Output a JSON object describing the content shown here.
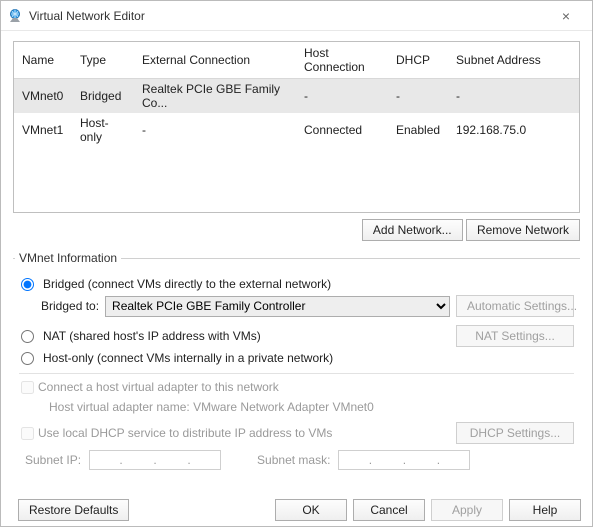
{
  "window": {
    "title": "Virtual Network Editor",
    "close_glyph": "×"
  },
  "table": {
    "headers": {
      "name": "Name",
      "type": "Type",
      "external": "External Connection",
      "host": "Host Connection",
      "dhcp": "DHCP",
      "subnet": "Subnet Address"
    },
    "rows": [
      {
        "name": "VMnet0",
        "type": "Bridged",
        "external": "Realtek PCIe GBE Family Co...",
        "host": "-",
        "dhcp": "-",
        "subnet": "-"
      },
      {
        "name": "VMnet1",
        "type": "Host-only",
        "external": "-",
        "host": "Connected",
        "dhcp": "Enabled",
        "subnet": "192.168.75.0"
      }
    ]
  },
  "buttons": {
    "add_network": "Add Network...",
    "remove_network": "Remove Network",
    "automatic_settings": "Automatic Settings...",
    "nat_settings": "NAT Settings...",
    "dhcp_settings": "DHCP Settings...",
    "restore_defaults": "Restore Defaults",
    "ok": "OK",
    "cancel": "Cancel",
    "apply": "Apply",
    "help": "Help"
  },
  "group": {
    "title": "VMnet Information",
    "bridged_label": "Bridged (connect VMs directly to the external network)",
    "bridged_to_label": "Bridged to:",
    "bridged_adapter": "Realtek PCIe GBE Family Controller",
    "nat_label": "NAT (shared host's IP address with VMs)",
    "hostonly_label": "Host-only (connect VMs internally in a private network)",
    "connect_host_adapter": "Connect a host virtual adapter to this network",
    "host_adapter_name": "Host virtual adapter name: VMware Network Adapter VMnet0",
    "use_dhcp": "Use local DHCP service to distribute IP address to VMs",
    "subnet_ip_label": "Subnet IP:",
    "subnet_mask_label": "Subnet mask:",
    "dot": "."
  }
}
